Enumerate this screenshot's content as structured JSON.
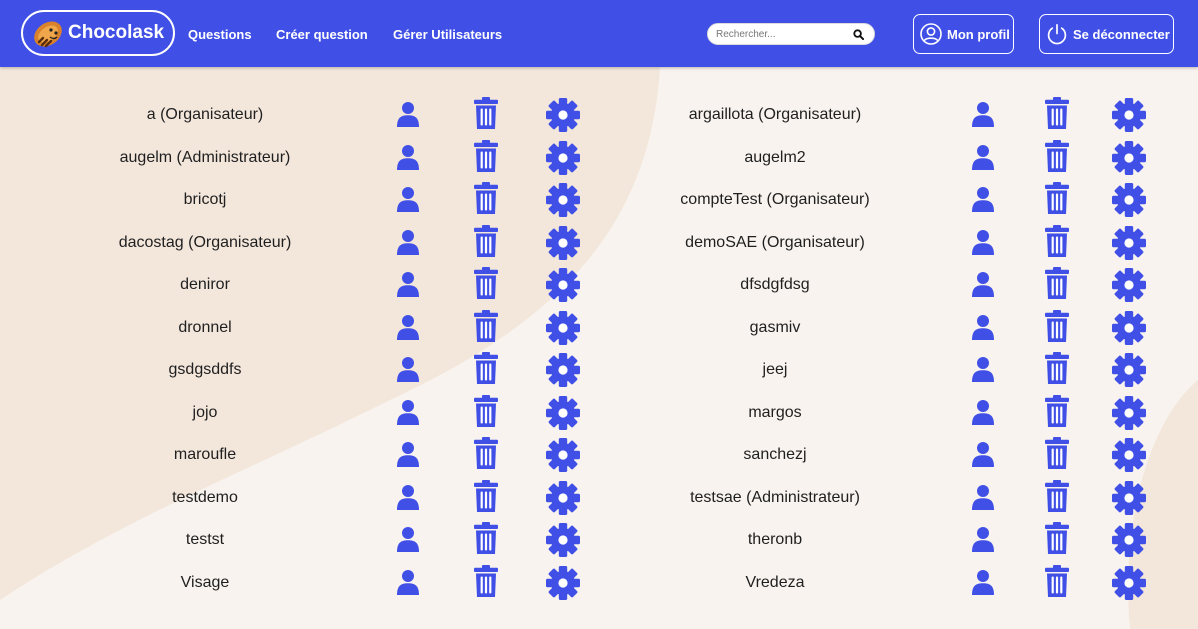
{
  "app": {
    "brand_name": "Chocolask",
    "accent_color": "#4050e6",
    "logo_icon": "chocolatine-icon"
  },
  "nav": {
    "links": [
      "Questions",
      "Créer question",
      "Gérer Utilisateurs"
    ],
    "search_placeholder": "Rechercher...",
    "search_icon": "search-icon",
    "profile_label": "Mon profil",
    "profile_icon": "user-circle-icon",
    "logout_label": "Se déconnecter",
    "logout_icon": "power-icon"
  },
  "actions_icons": [
    "user-icon",
    "trash-icon",
    "gear-icon"
  ],
  "users_left": [
    "a (Organisateur)",
    "augelm (Administrateur)",
    "bricotj",
    "dacostag (Organisateur)",
    "deniror",
    "dronnel",
    "gsdgsddfs",
    "jojo",
    "maroufle",
    "testdemo",
    "testst",
    "Visage"
  ],
  "users_right": [
    "argaillota (Organisateur)",
    "augelm2",
    "compteTest (Organisateur)",
    "demoSAE (Organisateur)",
    "dfsdgfdsg",
    "gasmiv",
    "jeej",
    "margos",
    "sanchezj",
    "testsae (Administrateur)",
    "theronb",
    "Vredeza"
  ]
}
